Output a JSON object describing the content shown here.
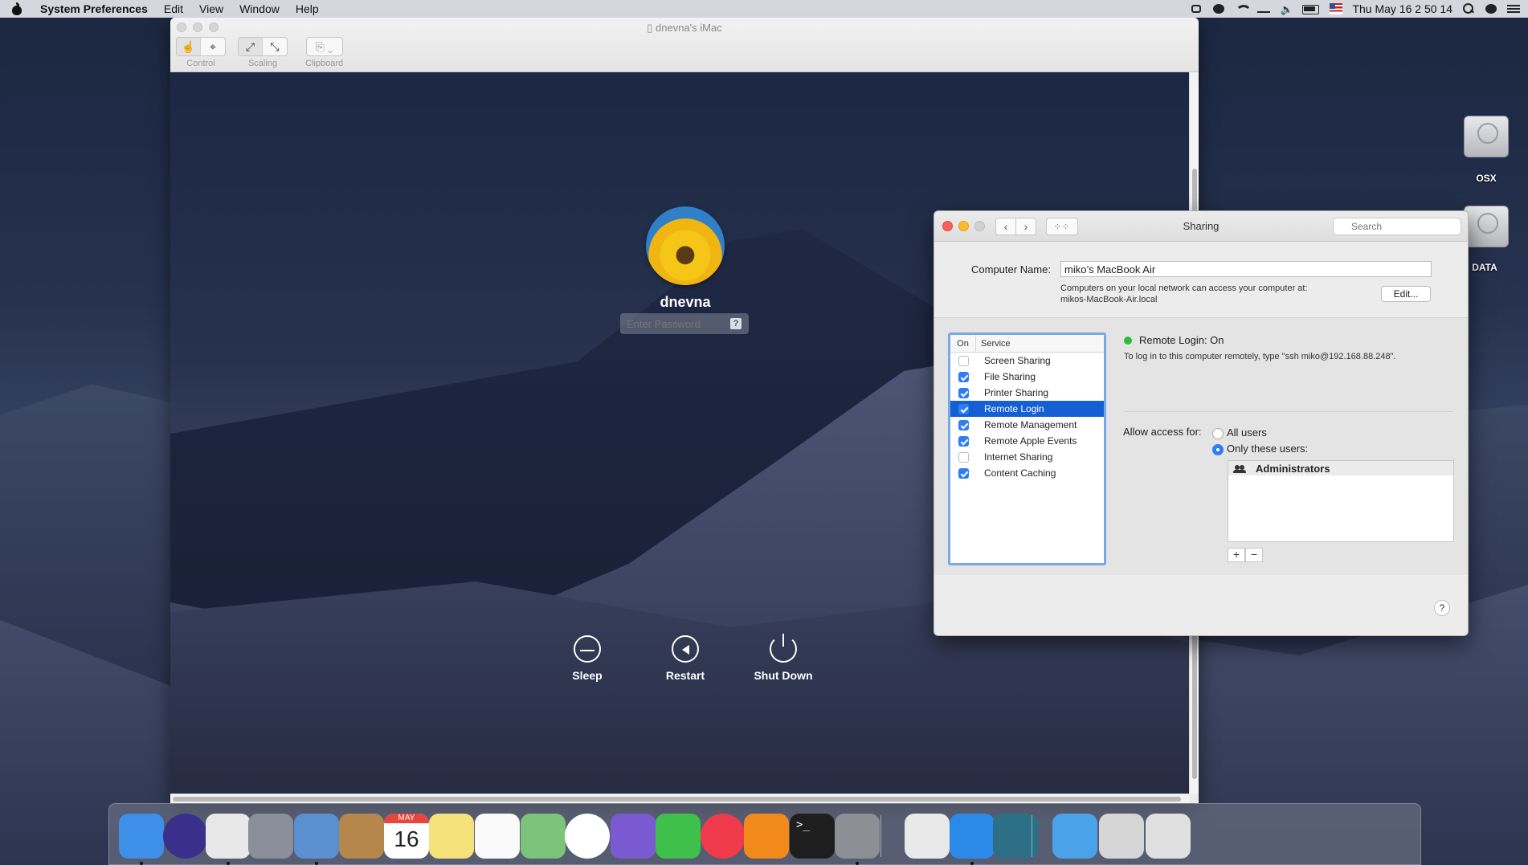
{
  "menubar": {
    "app_name": "System Preferences",
    "items": [
      "Edit",
      "View",
      "Window",
      "Help"
    ],
    "clock": "Thu May 16  2 50 14"
  },
  "remote_window": {
    "title": "dnevna's iMac",
    "toolbar": {
      "control_label": "Control",
      "scaling_label": "Scaling",
      "clipboard_label": "Clipboard"
    }
  },
  "login": {
    "username": "dnevna",
    "password_placeholder": "Enter Password",
    "help_glyph": "?",
    "sleep_label": "Sleep",
    "restart_label": "Restart",
    "shutdown_label": "Shut Down"
  },
  "sharing": {
    "title": "Sharing",
    "search_placeholder": "Search",
    "computer_name_label": "Computer Name:",
    "computer_name_value": "miko’s MacBook Air",
    "network_note_line1": "Computers on your local network can access your computer at:",
    "network_note_line2": "mikos-MacBook-Air.local",
    "edit_label": "Edit...",
    "col_on": "On",
    "col_service": "Service",
    "services": [
      {
        "name": "Screen Sharing",
        "on": false,
        "selected": false
      },
      {
        "name": "File Sharing",
        "on": true,
        "selected": false
      },
      {
        "name": "Printer Sharing",
        "on": true,
        "selected": false
      },
      {
        "name": "Remote Login",
        "on": true,
        "selected": true
      },
      {
        "name": "Remote Management",
        "on": true,
        "selected": false
      },
      {
        "name": "Remote Apple Events",
        "on": true,
        "selected": false
      },
      {
        "name": "Internet Sharing",
        "on": false,
        "selected": false
      },
      {
        "name": "Content Caching",
        "on": true,
        "selected": false
      }
    ],
    "status_text": "Remote Login: On",
    "status_note": "To log in to this computer remotely, type \"ssh miko@192.168.88.248\".",
    "allow_access_label": "Allow access for:",
    "radio_all": "All users",
    "radio_only": "Only these users:",
    "selected_access": "Only these users:",
    "users": [
      "Administrators"
    ],
    "add_glyph": "+",
    "remove_glyph": "−",
    "help_glyph": "?"
  },
  "desktop": {
    "disks": [
      "OSX",
      "DATA"
    ]
  },
  "dock": {
    "apps": [
      "finder-icon",
      "siri-icon",
      "chrome-icon",
      "launchpad-icon",
      "mail-icon",
      "contacts-icon",
      "calendar-icon",
      "notes-icon",
      "reminders-icon",
      "maps-icon",
      "photos-icon",
      "viber-icon",
      "facetime-icon",
      "news-icon",
      "vlc-icon",
      "terminal-icon",
      "system-preferences-icon",
      "textedit-icon",
      "safari-icon",
      "screen-sharing-icon",
      "downloads-folder-icon",
      "chrome-apps-icon",
      "trash-icon"
    ],
    "calendar_month": "MAY",
    "calendar_day": "16"
  },
  "colors": {
    "accent": "#2f7df6",
    "selection": "#1460d2",
    "status_green": "#2dbf3c"
  }
}
